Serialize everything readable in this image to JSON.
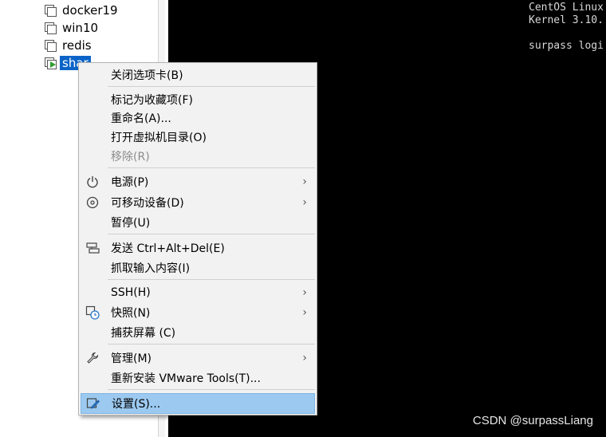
{
  "library": {
    "items": [
      {
        "label": "docker19",
        "state": "off"
      },
      {
        "label": "win10",
        "state": "off"
      },
      {
        "label": "redis",
        "state": "off"
      },
      {
        "label": "shar",
        "state": "running"
      }
    ]
  },
  "console": {
    "lines": [
      "CentOS Linux",
      "Kernel 3.10.",
      "",
      "surpass logi"
    ]
  },
  "watermark": "CSDN @surpassLiang",
  "menu": {
    "close_tab": "关闭选项卡(B)",
    "mark_favorite": "标记为收藏项(F)",
    "rename": "重命名(A)...",
    "open_dir": "打开虚拟机目录(O)",
    "remove": "移除(R)",
    "power": "电源(P)",
    "removable": "可移动设备(D)",
    "pause": "暂停(U)",
    "send_cad": "发送 Ctrl+Alt+Del(E)",
    "grab_input": "抓取输入内容(I)",
    "ssh": "SSH(H)",
    "snapshot": "快照(N)",
    "capture_screen": "捕获屏幕 (C)",
    "manage": "管理(M)",
    "reinstall_tools": "重新安装 VMware Tools(T)...",
    "settings": "设置(S)..."
  },
  "colors": {
    "console_bg": "#000000",
    "menu_bg": "#f2f2f2",
    "highlight": "#9cc9f0",
    "selection": "#0a64c8"
  }
}
